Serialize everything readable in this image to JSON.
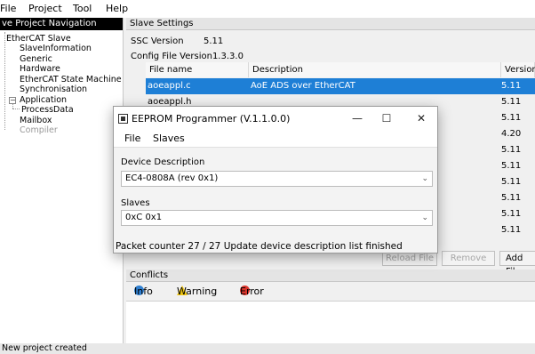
{
  "menubar": {
    "items": [
      "File",
      "Project",
      "Tool",
      "Help"
    ]
  },
  "tree": {
    "header": "ve Project Navigation",
    "items": [
      "EtherCAT Slave",
      "SlaveInformation",
      "Generic",
      "Hardware",
      "EtherCAT State Machine",
      "Synchronisation",
      "Application",
      "ProcessData",
      "Mailbox",
      "Compiler"
    ],
    "expander": "−"
  },
  "slave_settings": {
    "title": "Slave Settings",
    "ssc_label": "SSC Version",
    "ssc_value": "5.11",
    "config_label": "Config File Version1.3.3.0",
    "columns": [
      "File name",
      "Description",
      "Version"
    ],
    "rows": [
      {
        "file": "aoeappl.c",
        "description": "AoE ADS over EtherCAT",
        "version": "5.11"
      },
      {
        "file": "aoeappl.h",
        "description": "",
        "version": "5.11"
      },
      {
        "file": "",
        "description": "",
        "version": "5.11"
      },
      {
        "file": "",
        "description": "",
        "version": "4.20"
      },
      {
        "file": "",
        "description": "",
        "version": "5.11"
      },
      {
        "file": "",
        "description": "",
        "version": "5.11"
      },
      {
        "file": "",
        "description": "",
        "version": "5.11"
      },
      {
        "file": "",
        "description": "",
        "version": "5.11"
      },
      {
        "file": "",
        "description": "",
        "version": "5.11"
      },
      {
        "file": "",
        "description": "",
        "version": "5.11"
      }
    ],
    "buttons": {
      "reload": "Reload File",
      "remove": "Remove",
      "add": "Add Fil"
    }
  },
  "conflicts": {
    "title": "Conflicts",
    "tabs": {
      "info": "Info",
      "warning": "Warning",
      "error": "Error"
    }
  },
  "status": "New project created",
  "dialog": {
    "title": "EEPROM Programmer (V.1.1.0.0)",
    "window_buttons": {
      "minimize": "—",
      "maximize": "☐",
      "close": "✕"
    },
    "menu": [
      "File",
      "Slaves"
    ],
    "device_label": "Device Description",
    "device_value": "EC4-0808A (rev 0x1)",
    "slaves_label": "Slaves",
    "slaves_value": "0xC 0x1",
    "status": "Packet counter 27 / 27  Update device description list finished"
  },
  "colors": {
    "selection": "#1e7fd6",
    "info": "#2f7fd0",
    "warning": "#f2c811",
    "error": "#d9342b"
  },
  "icons": [
    "minimize-icon",
    "maximize-icon",
    "close-icon",
    "chevron-down-icon",
    "info-icon",
    "warning-icon",
    "error-icon",
    "app-icon"
  ]
}
